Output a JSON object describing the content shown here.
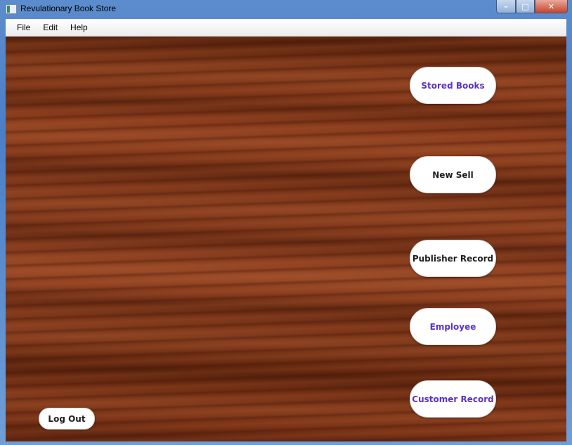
{
  "window": {
    "title": "Revulationary Book Store",
    "controls": [
      "minimize",
      "maximize",
      "close"
    ]
  },
  "menubar": {
    "items": [
      "File",
      "Edit",
      "Help"
    ]
  },
  "buttons": {
    "stored_books": "Stored Books",
    "new_sell": "New Sell",
    "publisher_record": "Publisher Record",
    "employee": "Employee",
    "customer_record": "Customer Record",
    "log_out": "Log Out"
  },
  "colors": {
    "accent_text": "#5a32c8",
    "background": "wood-texture"
  }
}
